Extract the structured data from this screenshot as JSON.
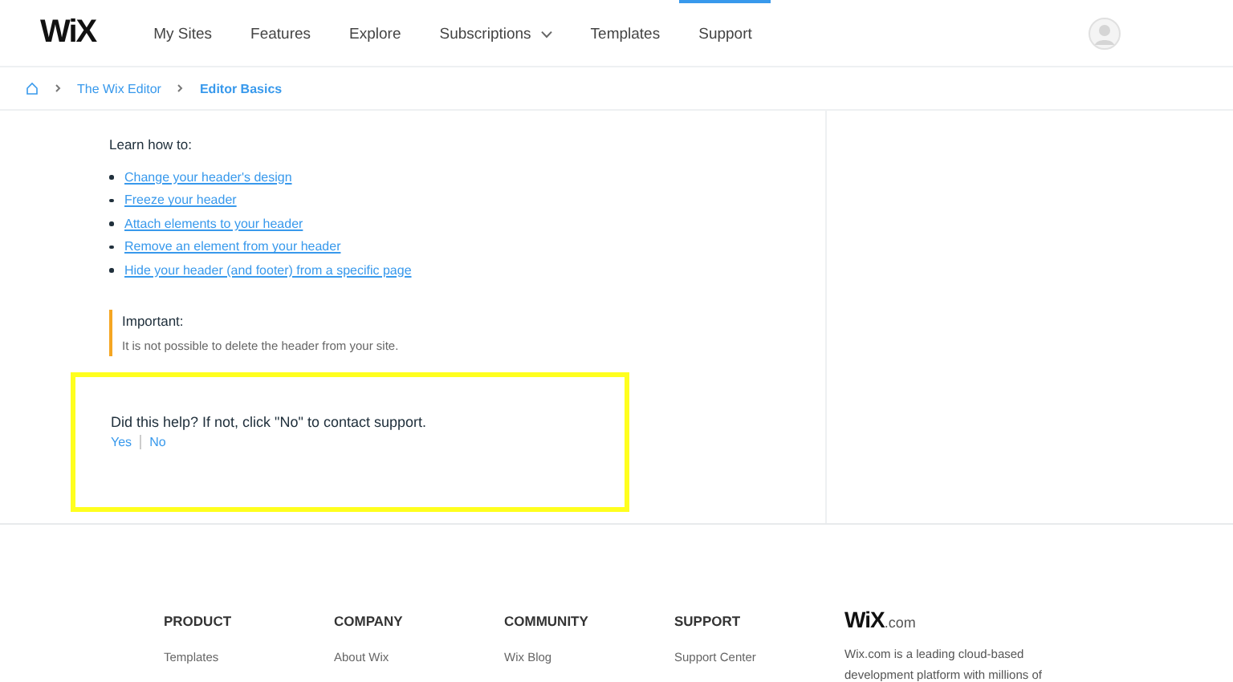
{
  "header": {
    "logo": "WiX",
    "nav": [
      {
        "label": "My Sites",
        "selected": false,
        "dropdown": false
      },
      {
        "label": "Features",
        "selected": false,
        "dropdown": false
      },
      {
        "label": "Explore",
        "selected": false,
        "dropdown": false
      },
      {
        "label": "Subscriptions",
        "selected": false,
        "dropdown": true
      },
      {
        "label": "Templates",
        "selected": false,
        "dropdown": false
      },
      {
        "label": "Support",
        "selected": true,
        "dropdown": false
      }
    ]
  },
  "breadcrumb": [
    "The Wix Editor",
    "Editor Basics"
  ],
  "article": {
    "intro": "Learn how to:",
    "links": [
      "Change your header's design",
      "Freeze your header",
      "Attach elements to your header",
      "Remove an element from your header",
      "Hide your header (and footer) from a specific page"
    ],
    "note": {
      "title": "Important:",
      "text": "It is not possible to delete the header from your site."
    }
  },
  "feedback": {
    "question": "Did this help? If not, click \"No\" to contact support.",
    "answers": [
      "Yes",
      "No"
    ]
  },
  "footer": {
    "columns": [
      {
        "title": "PRODUCT",
        "links": [
          "Templates"
        ]
      },
      {
        "title": "COMPANY",
        "links": [
          "About Wix"
        ]
      },
      {
        "title": "COMMUNITY",
        "links": [
          "Wix Blog"
        ]
      },
      {
        "title": "SUPPORT",
        "links": [
          "Support Center"
        ]
      }
    ],
    "brand": {
      "name": "WiX",
      "suffix": ".com",
      "description": "Wix.com is a leading cloud-based development platform with millions of"
    }
  }
}
